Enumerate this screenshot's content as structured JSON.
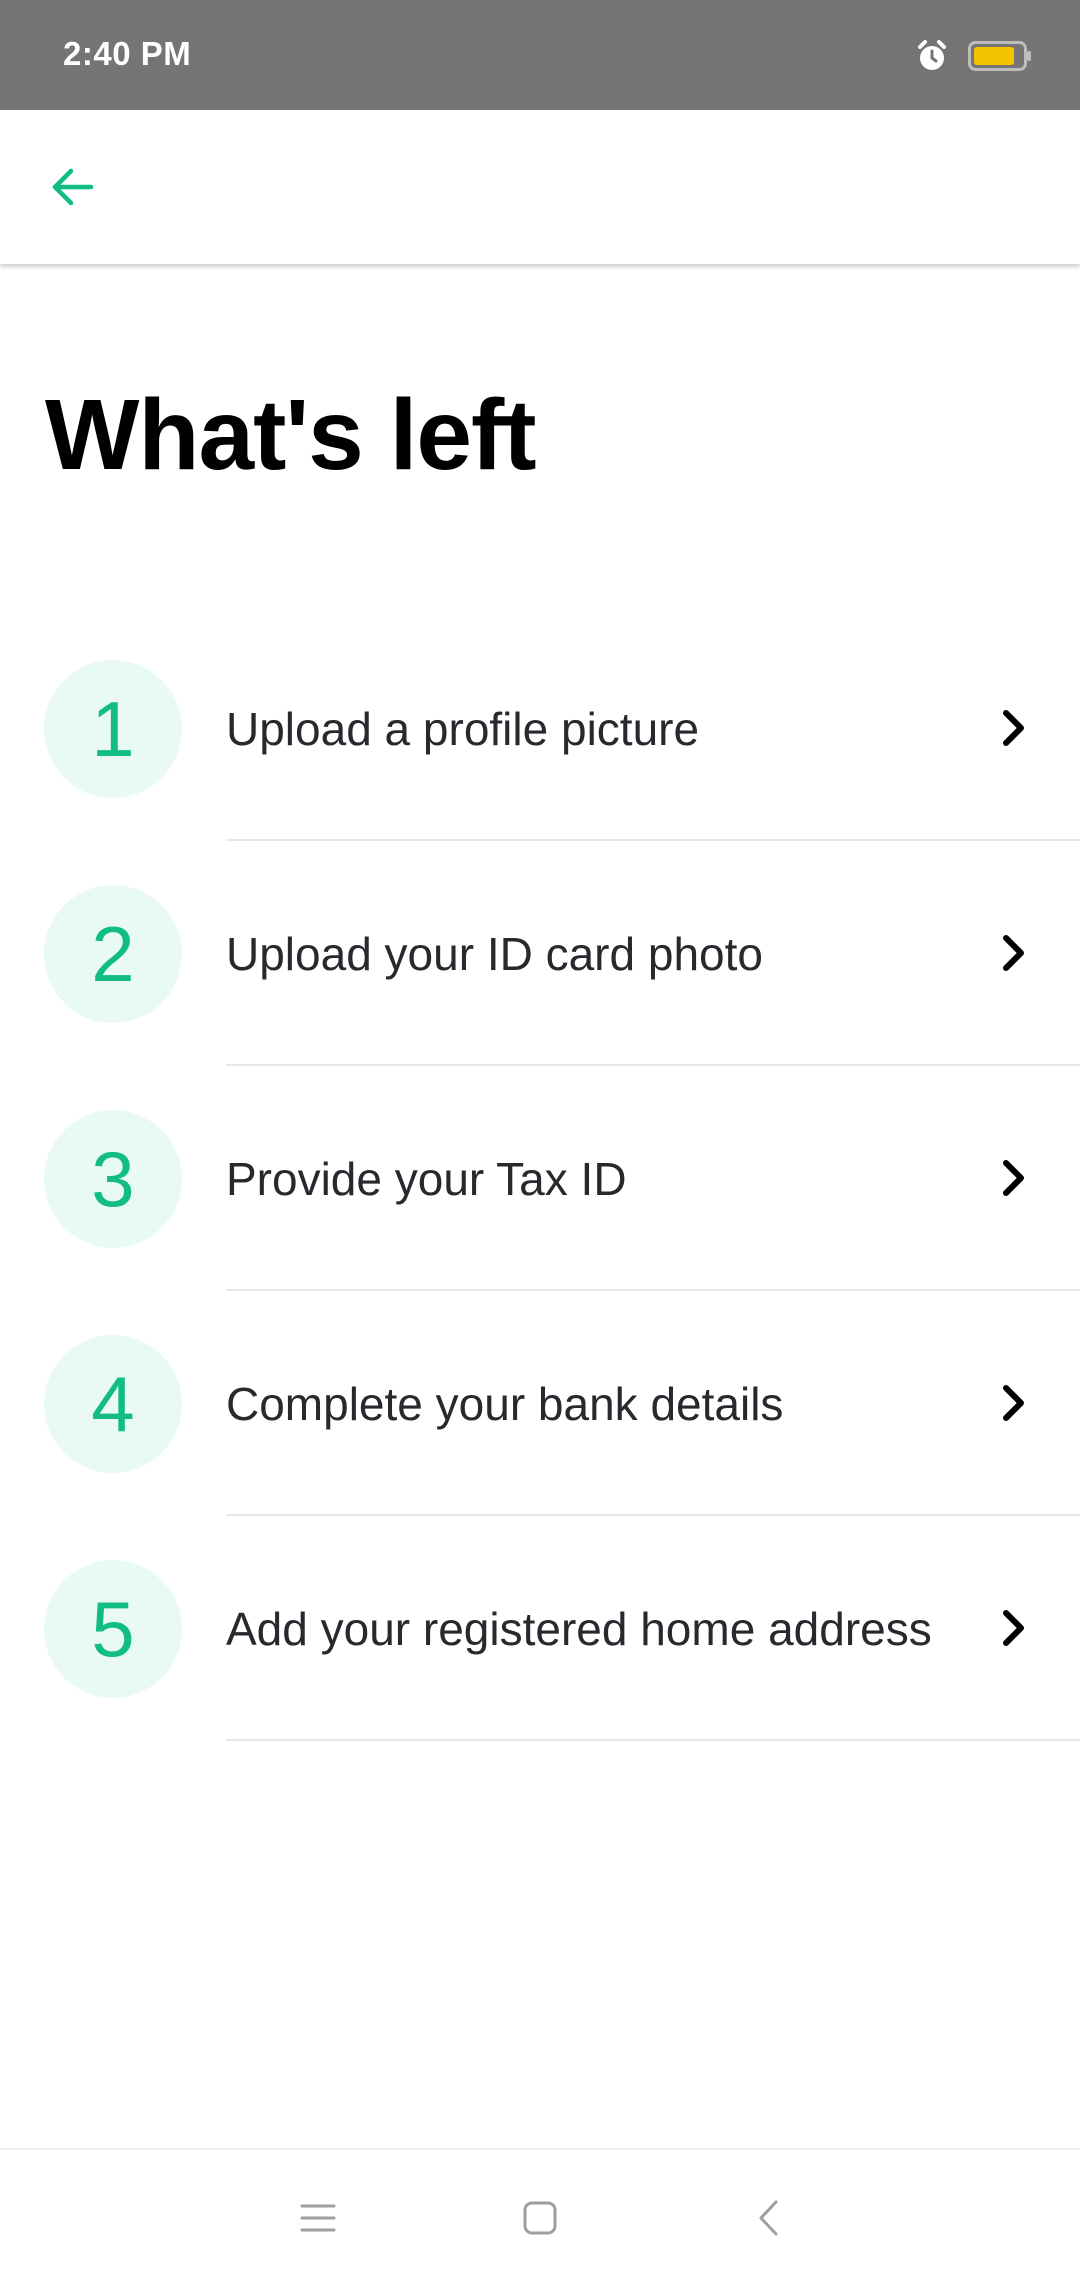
{
  "status_bar": {
    "time": "2:40 PM",
    "icons": [
      "alarm-icon",
      "battery-icon"
    ],
    "battery_color": "#f5c400"
  },
  "app_bar": {
    "back_icon": "arrow-left-icon",
    "accent_color": "#12bd84"
  },
  "page": {
    "title": "What's left"
  },
  "steps": [
    {
      "number": "1",
      "label": "Upload a profile picture",
      "icon": "chevron-right-icon"
    },
    {
      "number": "2",
      "label": "Upload your ID card photo",
      "icon": "chevron-right-icon"
    },
    {
      "number": "3",
      "label": "Provide your Tax ID",
      "icon": "chevron-right-icon"
    },
    {
      "number": "4",
      "label": "Complete your bank details",
      "icon": "chevron-right-icon"
    },
    {
      "number": "5",
      "label": "Add your registered home address",
      "icon": "chevron-right-icon"
    }
  ],
  "bottom_nav": {
    "icons": [
      "menu-icon",
      "home-square-icon",
      "back-chevron-icon"
    ]
  }
}
